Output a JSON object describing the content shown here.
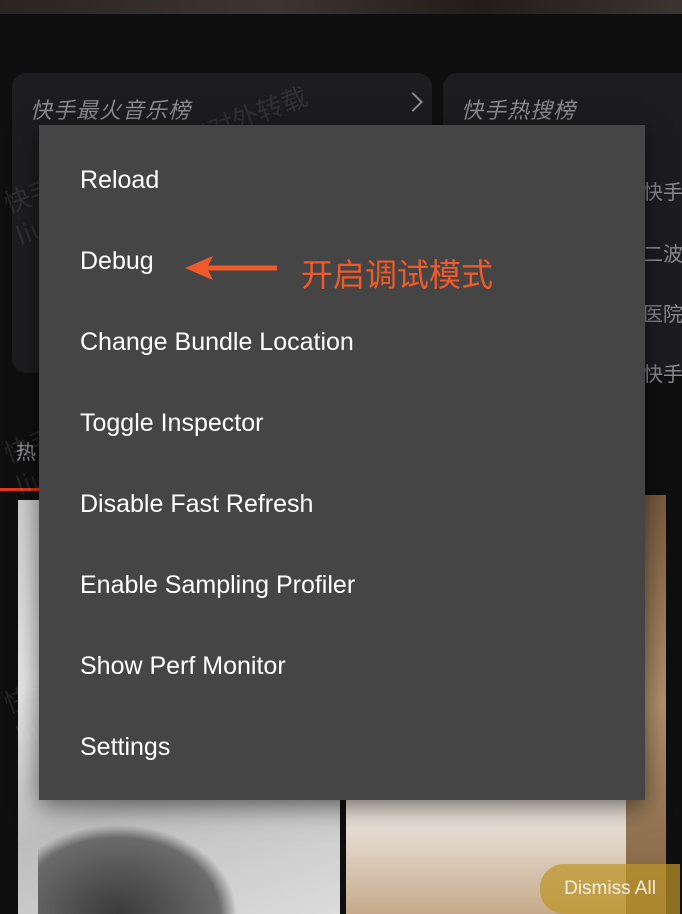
{
  "background": {
    "card_left_title": "快手最火音乐榜",
    "card_right_title": "快手热搜榜",
    "right_snippets": [
      "快手",
      "二波",
      "医院",
      "快手"
    ],
    "hot_label": "热"
  },
  "menu": {
    "items": [
      {
        "label": "Reload"
      },
      {
        "label": "Debug"
      },
      {
        "label": "Change Bundle Location"
      },
      {
        "label": "Toggle Inspector"
      },
      {
        "label": "Disable Fast Refresh"
      },
      {
        "label": "Enable Sampling Profiler"
      },
      {
        "label": "Show Perf Monitor"
      },
      {
        "label": "Settings"
      }
    ]
  },
  "annotation": {
    "text": "开启调试模式",
    "color": "#f05a28"
  },
  "watermark": {
    "line1": "快手内部信息 请勿对外转载",
    "line2": "liubojie 1589439703"
  },
  "dismiss": {
    "label": "Dismiss All"
  },
  "colors": {
    "menu_bg": "#454545",
    "accent_red": "#e03524"
  }
}
